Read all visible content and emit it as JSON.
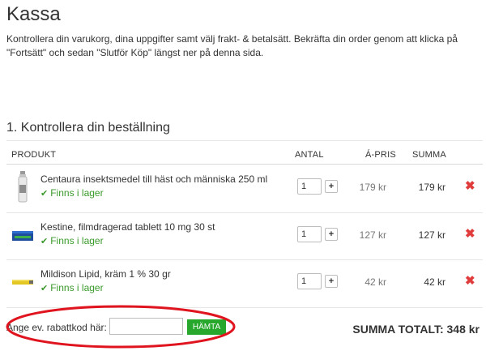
{
  "page": {
    "title": "Kassa",
    "intro": "Kontrollera din varukorg, dina uppgifter samt välj frakt- & betalsätt. Bekräfta din order genom att klicka på \"Fortsätt\" och sedan \"Slutför Köp\" längst ner på denna sida."
  },
  "cart": {
    "section_title": "1. Kontrollera din beställning",
    "headers": {
      "product": "PRODUKT",
      "qty": "ANTAL",
      "unit_price": "Á-PRIS",
      "sum": "SUMMA"
    },
    "items": [
      {
        "name": "Centaura insektsmedel till häst och människa 250 ml",
        "stock": "Finns i lager",
        "qty": "1",
        "plus": "+",
        "unit_price": "179 kr",
        "sum": "179 kr",
        "remove": "✖",
        "icon": "spray-bottle-icon"
      },
      {
        "name": "Kestine, filmdragerad tablett 10 mg 30 st",
        "stock": "Finns i lager",
        "qty": "1",
        "plus": "+",
        "unit_price": "127 kr",
        "sum": "127 kr",
        "remove": "✖",
        "icon": "blister-pack-icon"
      },
      {
        "name": "Mildison Lipid, kräm 1 % 30 gr",
        "stock": "Finns i lager",
        "qty": "1",
        "plus": "+",
        "unit_price": "42 kr",
        "sum": "42 kr",
        "remove": "✖",
        "icon": "cream-tube-icon"
      }
    ],
    "stock_check_glyph": "✔"
  },
  "discount": {
    "label": "Ange ev. rabattkod här:",
    "value": "",
    "button": "HÄMTA"
  },
  "total": "SUMMA TOTALT: 348 kr",
  "colors": {
    "in_stock": "#3a9a2b",
    "button": "#27a72b",
    "remove": "#e03c3c",
    "annotation": "#e0141e"
  }
}
